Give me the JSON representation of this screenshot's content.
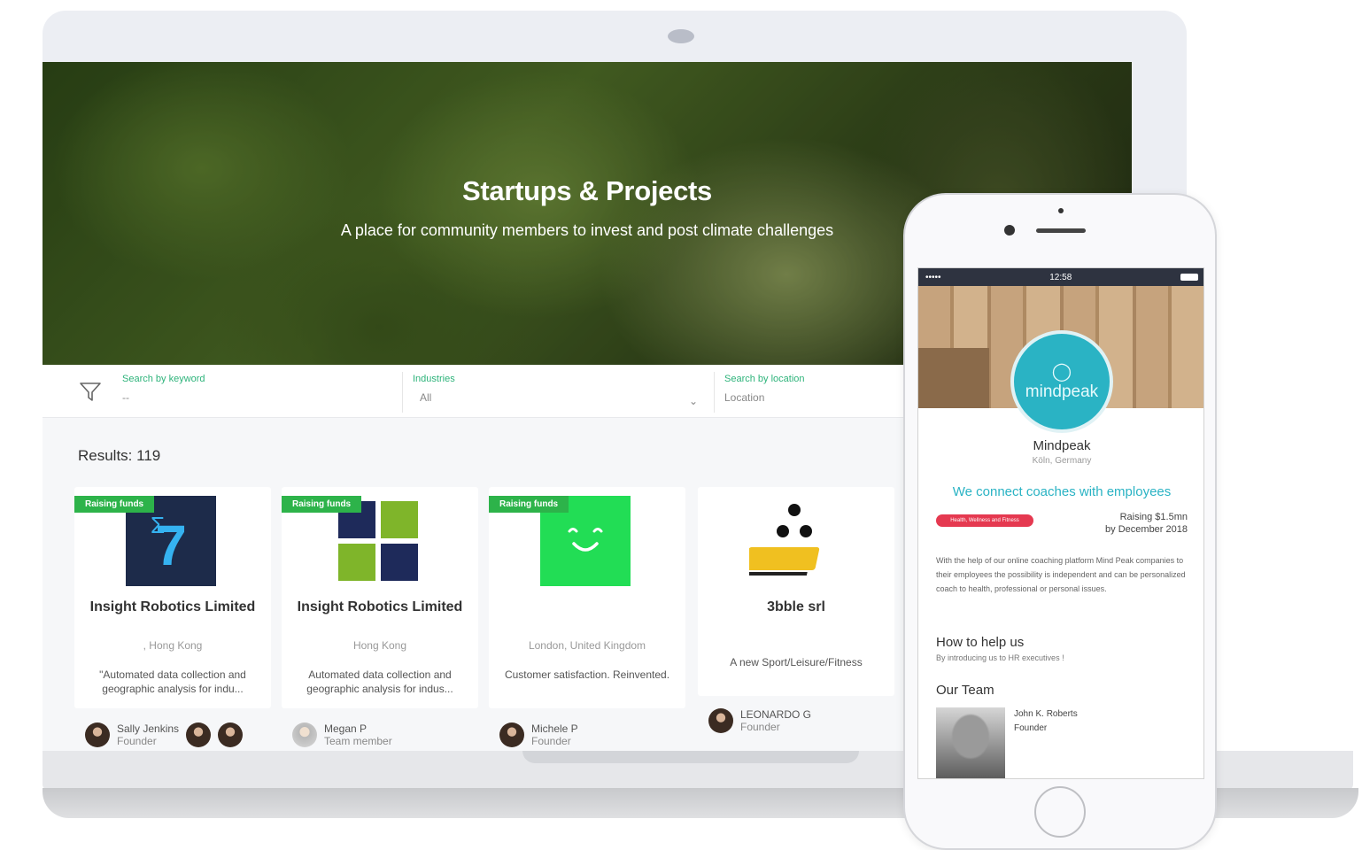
{
  "hero": {
    "title": "Startups & Projects",
    "subtitle": "A place for community members to invest and post climate challenges"
  },
  "filters": {
    "keyword_label": "Search by keyword",
    "keyword_value": "--",
    "industries_label": "Industries",
    "industries_value": "All",
    "location_label": "Search by location",
    "location_value": "Location"
  },
  "results_label": "Results: 119",
  "cards": [
    {
      "badge": "Raising funds",
      "title": "Insight Robotics Limited",
      "location": ", Hong Kong",
      "description": "\"Automated data collection and geographic analysis for indu...",
      "person": "Sally Jenkins",
      "role": "Founder"
    },
    {
      "badge": "Raising funds",
      "title": "Insight Robotics Limited",
      "location": "Hong Kong",
      "description": "Automated data collection and geographic analysis for indus...",
      "person": "Megan P",
      "role": "Team member"
    },
    {
      "badge": "Raising funds",
      "title": "",
      "location": "London, United Kingdom",
      "description": "Customer satisfaction. Reinvented.",
      "person": "Michele P",
      "role": "Founder"
    },
    {
      "badge": "",
      "title": "3bble srl",
      "location": "",
      "description": "A new Sport/Leisure/Fitness",
      "person": "LEONARDO G",
      "role": "Founder"
    }
  ],
  "phone": {
    "status_time": "12:58",
    "logo_text": "mindpeak",
    "company": "Mindpeak",
    "city": "Köln, Germany",
    "tagline": "We connect coaches with employees",
    "tag": "Health, Wellness and Fitness",
    "raising_line1": "Raising $1.5mn",
    "raising_line2": "by December 2018",
    "body": "With the help of our online coaching platform Mind Peak companies to their employees the possibility is independent and can be personalized coach to health, professional or personal issues.",
    "help_heading": "How to help us",
    "help_sub": "By introducing us to HR executives !",
    "team_heading": "Our Team",
    "member_name": "John K. Roberts",
    "member_role": "Founder"
  },
  "colors": {
    "accent_green": "#2db34a",
    "link_green": "#2db37a",
    "phone_accent": "#2ab3c4",
    "tag_red": "#e53950"
  }
}
